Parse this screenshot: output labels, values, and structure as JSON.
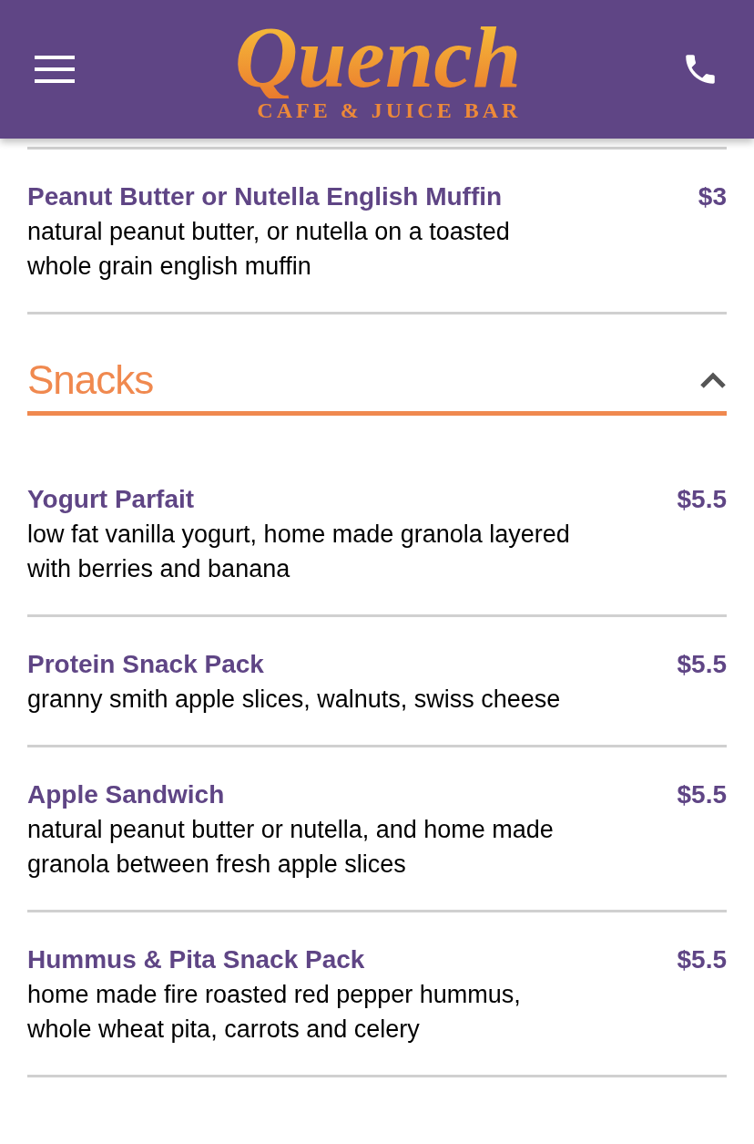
{
  "header": {
    "logo_name": "Quench",
    "logo_tagline": "CAFE & JUICE BAR"
  },
  "top_items": [
    {
      "name": "Peanut Butter or Nutella English Muffin",
      "price": "$3",
      "description": "natural peanut butter, or nutella on a toasted whole grain english muffin"
    }
  ],
  "section": {
    "title": "Snacks",
    "expanded": true,
    "items": [
      {
        "name": "Yogurt Parfait",
        "price": "$5.5",
        "description": "low fat vanilla yogurt, home made granola layered with berries and banana"
      },
      {
        "name": "Protein Snack Pack",
        "price": "$5.5",
        "description": "granny smith apple slices, walnuts, swiss cheese"
      },
      {
        "name": "Apple Sandwich",
        "price": "$5.5",
        "description": "natural peanut butter or nutella, and home made granola between fresh apple slices"
      },
      {
        "name": "Hummus & Pita Snack Pack",
        "price": "$5.5",
        "description": "home made fire roasted red pepper hummus, whole wheat pita, carrots and celery"
      }
    ]
  }
}
